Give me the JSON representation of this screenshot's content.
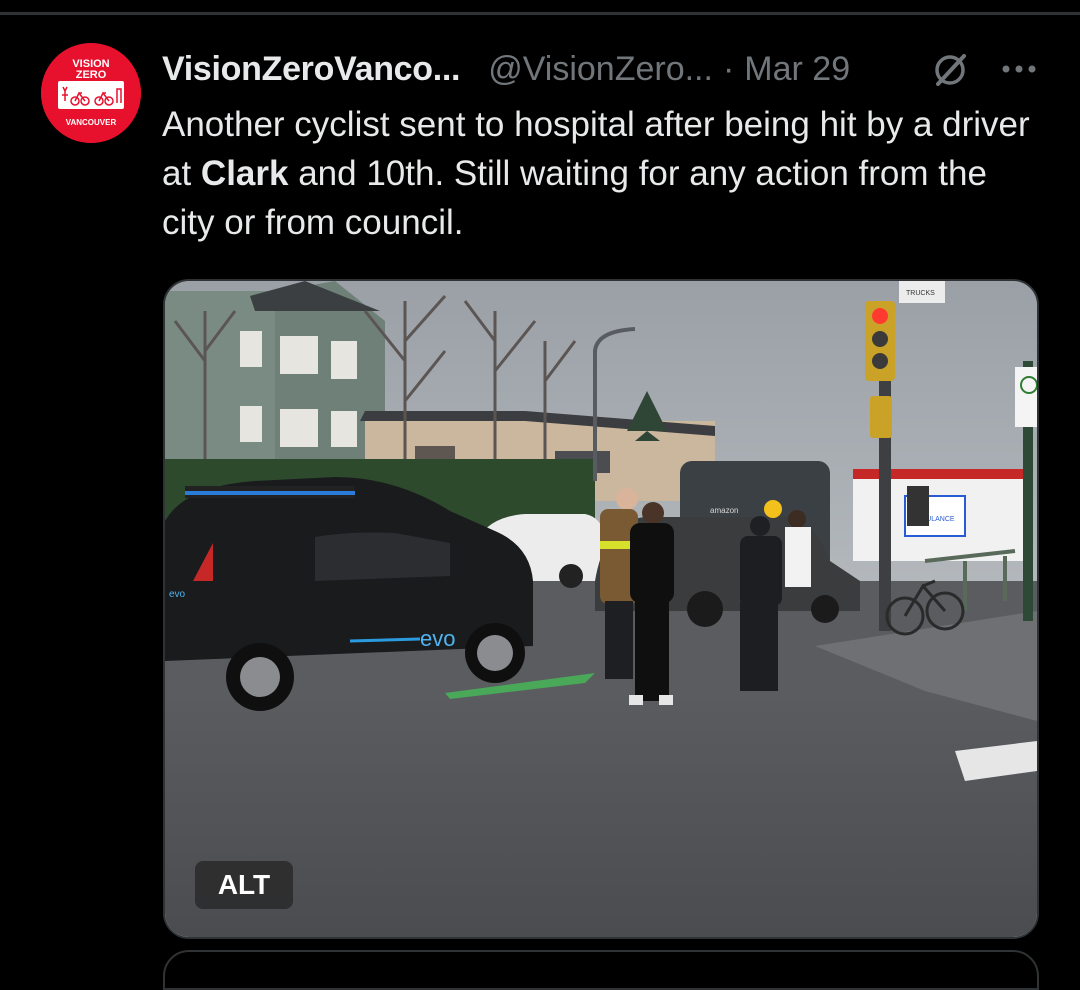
{
  "tweet": {
    "display_name": "VisionZeroVanco...",
    "handle": "@VisionZero...",
    "separator": "·",
    "date": "Mar 29",
    "text_before_bold": "Another cyclist sent to hospital after being hit by a driver at ",
    "text_bold": "Clark",
    "text_after_bold": " and 10th. Still waiting for any action from the city or from council.",
    "alt_badge": "ALT"
  },
  "avatar": {
    "logo_top": "VISION",
    "logo_mid": "ZERO",
    "logo_bottom": "VANCOUVER",
    "color": "#e8112d"
  },
  "photo": {
    "sign_trucks": "TRUCKS",
    "car_brand": "evo",
    "car_brand_rear": "evo",
    "van_label": "amazon",
    "ambulance_label": "AMBULANCE"
  },
  "icons": {
    "grok": "grok-icon",
    "more": "more-icon"
  },
  "colors": {
    "background": "#000000",
    "text": "#e7e9ea",
    "secondary_text": "#71767b",
    "divider": "#2f3336"
  }
}
